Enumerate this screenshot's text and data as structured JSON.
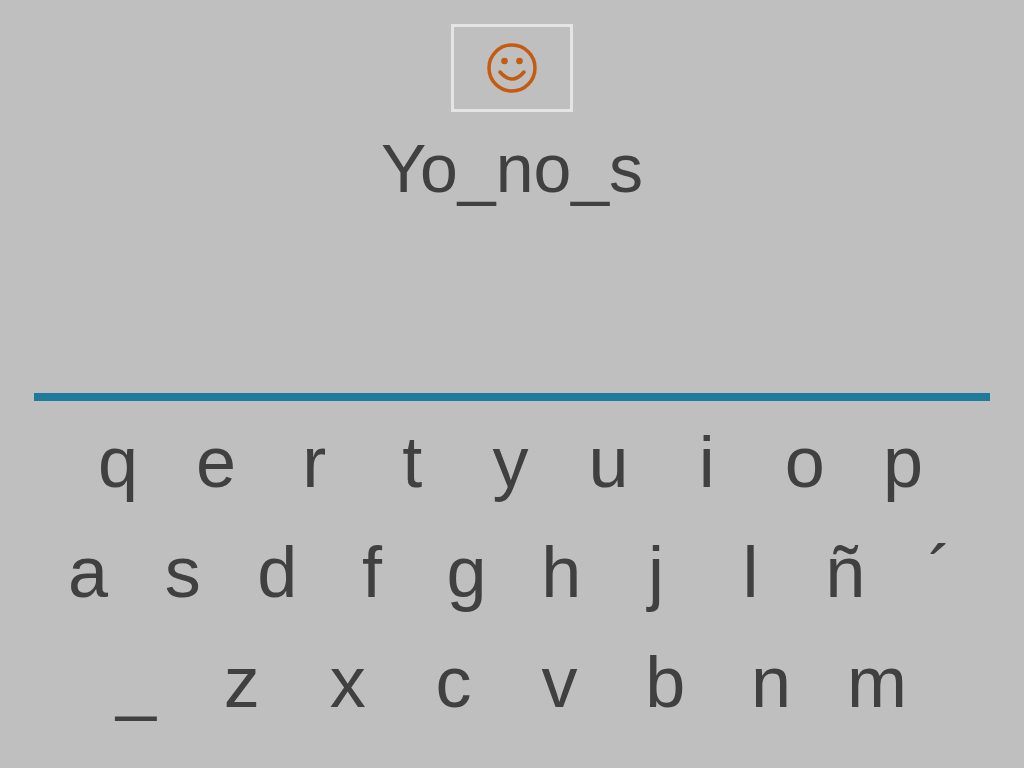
{
  "word": "Yo_no_s",
  "keyboard": {
    "rows": [
      [
        "q",
        "e",
        "r",
        "t",
        "y",
        "u",
        "i",
        "o",
        "p"
      ],
      [
        "a",
        "s",
        "d",
        "f",
        "g",
        "h",
        "j",
        "l",
        "ñ",
        "´"
      ],
      [
        "_",
        "z",
        "x",
        "c",
        "v",
        "b",
        "n",
        "m"
      ]
    ]
  }
}
